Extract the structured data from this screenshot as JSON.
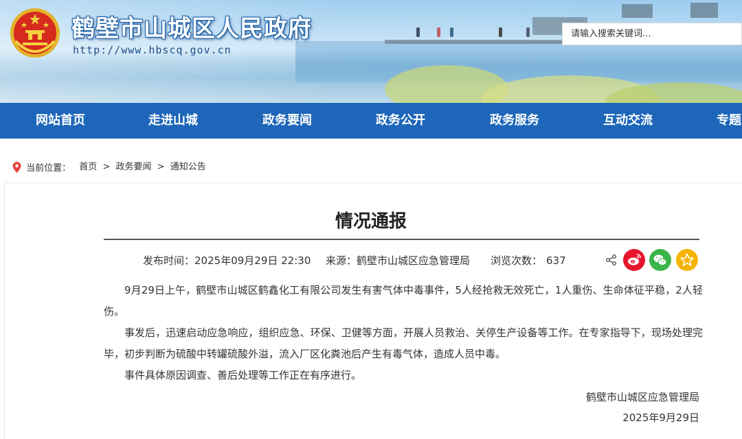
{
  "header": {
    "site_title": "鹤壁市山城区人民政府",
    "site_url": "http://www.hbscq.gov.cn",
    "emblem_icon": "national-emblem-icon",
    "search_placeholder": "请输入搜索关键词..."
  },
  "nav": {
    "items": [
      "网站首页",
      "走进山城",
      "政务要闻",
      "政务公开",
      "政务服务",
      "互动交流",
      "专题"
    ]
  },
  "breadcrumb": {
    "label": "当前位置：",
    "items": [
      "首页",
      "政务要闻",
      "通知公告"
    ],
    "separator": ">"
  },
  "article": {
    "title": "情况通报",
    "meta": {
      "time_label": "发布时间：",
      "time": "2025年09月29日 22:30",
      "source_label": "来源：",
      "source": "鹤壁市山城区应急管理局",
      "views_label": "浏览次数：",
      "views": "637"
    },
    "share_icons": [
      "share-icon",
      "weibo-icon",
      "wechat-icon",
      "favorite-star-icon"
    ],
    "paragraphs": [
      "9月29日上午，鹤壁市山城区鹤鑫化工有限公司发生有害气体中毒事件，5人经抢救无效死亡，1人重伤、生命体征平稳，2人轻伤。",
      "事发后，迅速启动应急响应，组织应急、环保、卫健等方面，开展人员救治、关停生产设备等工作。在专家指导下，现场处理完毕，初步判断为硫酸中转罐硫酸外溢，流入厂区化粪池后产生有毒气体，造成人员中毒。",
      "事件具体原因调查、善后处理等工作正在有序进行。"
    ],
    "signature": "鹤壁市山城区应急管理局",
    "signature_date": "2025年9月29日"
  },
  "colors": {
    "nav_bg": "#1d66b9",
    "title_outline": "#1b5fa8",
    "weibo": "#e6162d",
    "wechat": "#3bb54a",
    "favorite": "#f5b400",
    "pin": "#e8443a"
  }
}
